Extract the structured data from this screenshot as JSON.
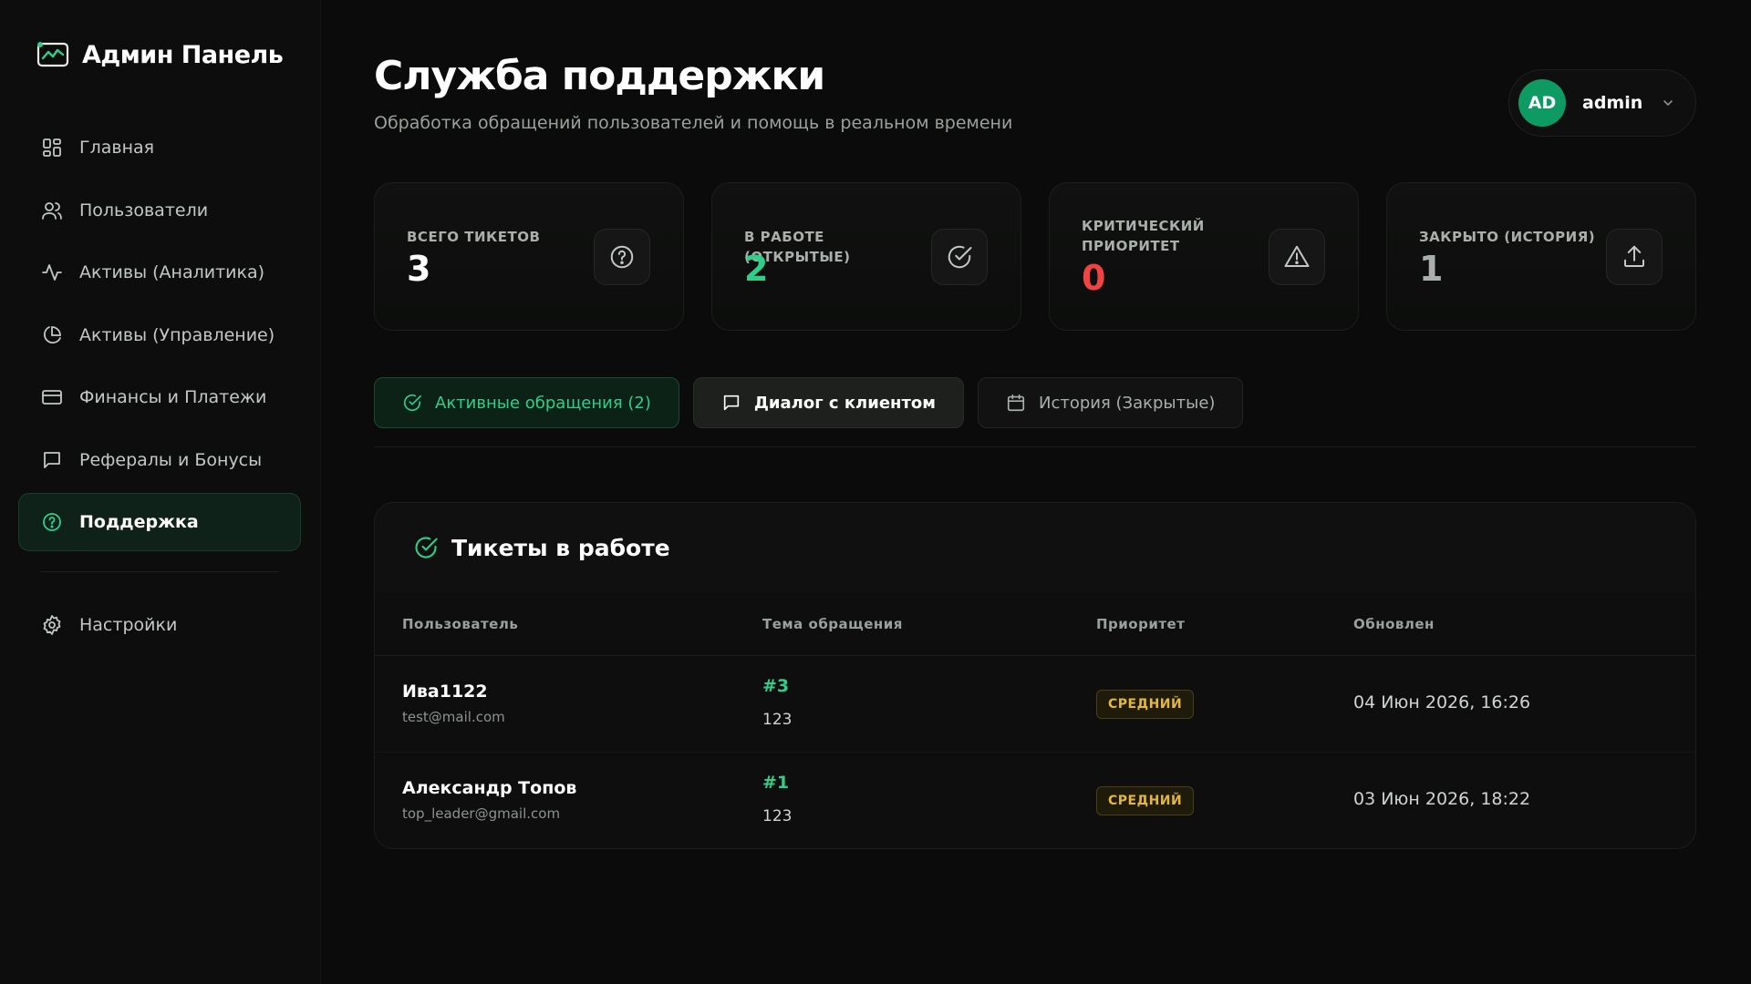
{
  "app": {
    "title": "Админ Панель",
    "accent": "#2ecf8b"
  },
  "sidebar": {
    "items": [
      {
        "label": "Главная",
        "icon": "grid-icon"
      },
      {
        "label": "Пользователи",
        "icon": "users-icon"
      },
      {
        "label": "Активы (Аналитика)",
        "icon": "activity-icon"
      },
      {
        "label": "Активы (Управление)",
        "icon": "pie-chart-icon"
      },
      {
        "label": "Финансы и Платежи",
        "icon": "credit-card-icon"
      },
      {
        "label": "Рефералы и Бонусы",
        "icon": "message-icon"
      },
      {
        "label": "Поддержка",
        "icon": "help-circle-icon",
        "active": true
      }
    ],
    "settings_label": "Настройки"
  },
  "header": {
    "title": "Служба поддержки",
    "subtitle": "Обработка обращений пользователей и помощь в реальном времени"
  },
  "user": {
    "initials": "AD",
    "name": "admin"
  },
  "stats": [
    {
      "label": "Всего тикетов",
      "value": "3",
      "color": "#ffffff",
      "icon": "help-circle-icon"
    },
    {
      "label": "В работе (открытые)",
      "value": "2",
      "color": "#2ecf8b",
      "icon": "check-circle-icon"
    },
    {
      "label": "Критический приоритет",
      "value": "0",
      "color": "#f04444",
      "icon": "alert-triangle-icon"
    },
    {
      "label": "Закрыто (история)",
      "value": "1",
      "color": "#a9b0ab",
      "icon": "upload-icon"
    }
  ],
  "tabs": [
    {
      "label": "Активные обращения (2)",
      "icon": "check-circle-icon"
    },
    {
      "label": "Диалог с клиентом",
      "icon": "message-icon"
    },
    {
      "label": "История (Закрытые)",
      "icon": "calendar-icon"
    }
  ],
  "panel": {
    "title": "Тикеты в работе",
    "columns": [
      "Пользователь",
      "Тема обращения",
      "Приоритет",
      "Обновлен"
    ],
    "rows": [
      {
        "name": "Ива1122",
        "email": "test@mail.com",
        "ticket_id": "#3",
        "subject": "123",
        "priority": "СРЕДНИЙ",
        "updated": "04 Июн 2026, 16:26"
      },
      {
        "name": "Александр Топов",
        "email": "top_leader@gmail.com",
        "ticket_id": "#1",
        "subject": "123",
        "priority": "СРЕДНИЙ",
        "updated": "03 Июн 2026, 18:22"
      }
    ]
  }
}
